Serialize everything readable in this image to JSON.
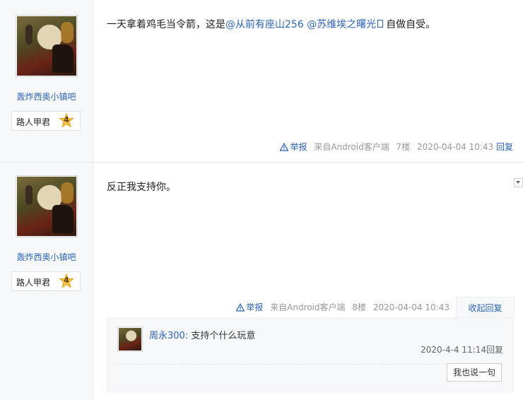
{
  "posts": [
    {
      "username": "轰炸西奥小镇吧",
      "badge_title": "路人甲君",
      "badge_level": "4",
      "content_prefix": "一天拿着鸡毛当令箭，这是",
      "mention_1": "@从前有座山256",
      "mention_2": "@苏维埃之曙光",
      "content_suffix": "自做自受。",
      "report": "举报",
      "source": "来自Android客户端",
      "floor": "7楼",
      "time": "2020-04-04 10:43",
      "reply_link": "回复"
    },
    {
      "username": "轰炸西奥小镇吧",
      "badge_title": "路人甲君",
      "badge_level": "4",
      "content": "反正我支持你。",
      "report": "举报",
      "source": "来自Android客户端",
      "floor": "8楼",
      "time": "2020-04-04 10:43",
      "collapse_label": "收起回复",
      "sub_reply": {
        "author": "周永300:",
        "text": "支持个什么玩意",
        "time": "2020-4-4 11:14",
        "reply_link": "回复"
      },
      "say_button": "我也说一句"
    }
  ],
  "colors": {
    "link": "#2d64b3",
    "meta": "#999999",
    "sidebar_bg": "#f7f8fa"
  },
  "icons": [
    "warning-icon",
    "star-badge-icon",
    "dropdown-icon"
  ]
}
